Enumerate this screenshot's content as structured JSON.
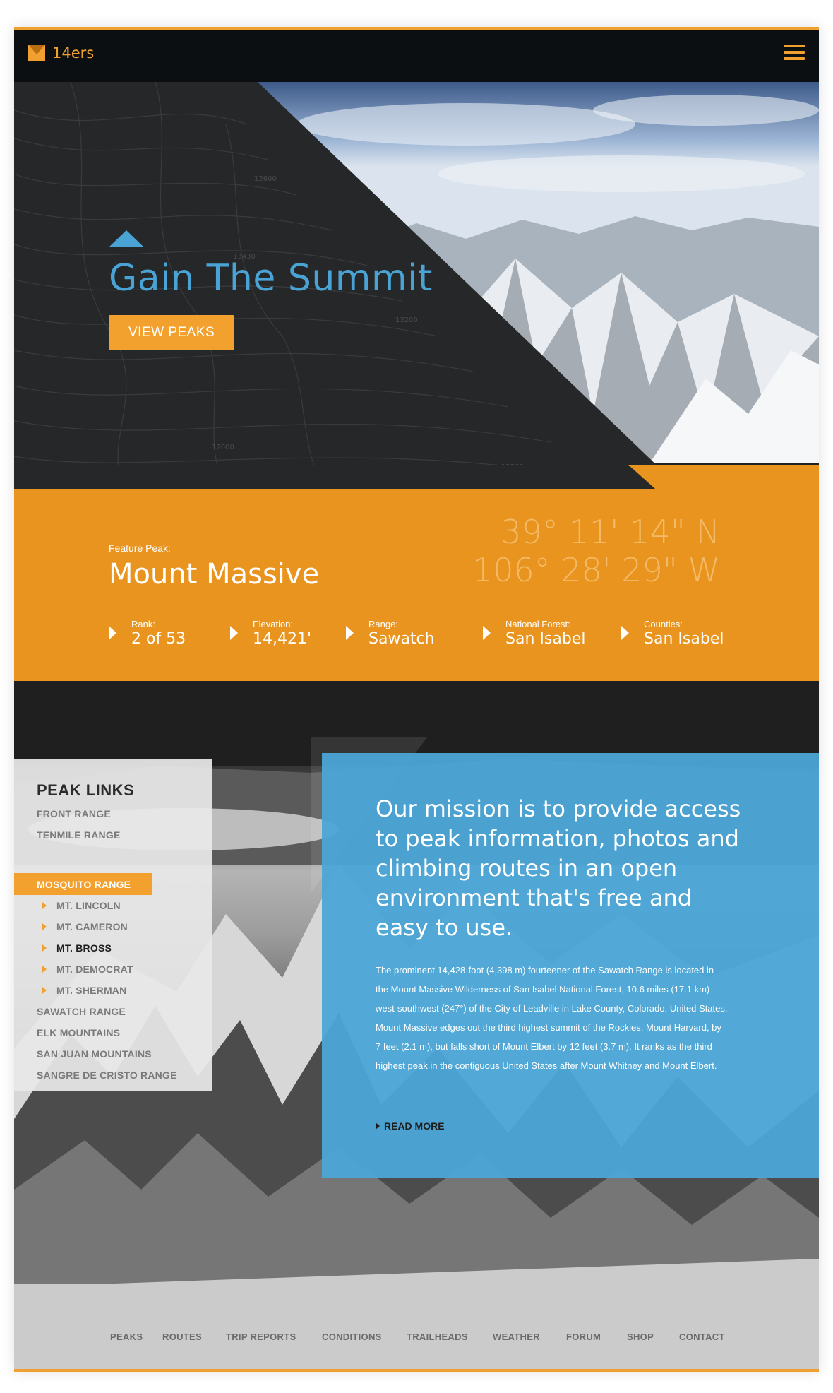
{
  "brand": {
    "name": "14ers",
    "accent": "#f1a02f",
    "blue": "#4aa3d5"
  },
  "header": {
    "menu_icon": "hamburger-icon"
  },
  "hero": {
    "title": "Gain The Summit",
    "button": "VIEW PEAKS"
  },
  "feature": {
    "label": "Feature Peak:",
    "name": "Mount Massive",
    "lat": "39° 11' 14\" N",
    "lon": "106° 28' 29\" W",
    "stats": [
      {
        "label": "Rank:",
        "value": "2 of 53"
      },
      {
        "label": "Elevation:",
        "value": "14,421'"
      },
      {
        "label": "Range:",
        "value": "Sawatch"
      },
      {
        "label": "National Forest:",
        "value": "San Isabel"
      },
      {
        "label": "Counties:",
        "value": "San Isabel"
      }
    ]
  },
  "peak_links": {
    "title": "PEAK LINKS",
    "items": [
      "FRONT RANGE",
      "TENMILE RANGE",
      "MOSQUITO RANGE",
      "MT. LINCOLN",
      "MT. CAMERON",
      "MT. BROSS",
      "MT. DEMOCRAT",
      "MT. SHERMAN",
      "SAWATCH RANGE",
      "ELK MOUNTAINS",
      "SAN JUAN MOUNTAINS",
      "SANGRE DE CRISTO RANGE"
    ]
  },
  "mission": {
    "heading": "Our mission is to provide access to peak information, photos and climbing routes in an open environment that's free and easy to use.",
    "body": "The prominent 14,428-foot (4,398 m) fourteener of the Sawatch Range is located in the Mount Massive Wilderness of San Isabel National Forest, 10.6 miles (17.1 km) west-southwest (247°) of the City of Leadville in Lake County, Colorado, United States. Mount Massive edges out the third highest summit of the Rockies, Mount Harvard, by 7 feet (2.1 m), but falls short of Mount Elbert by 12 feet (3.7 m). It ranks as the third highest peak in the contiguous United States after Mount Whitney and Mount Elbert.",
    "read_more": "READ MORE"
  },
  "footer": {
    "links": [
      "PEAKS",
      "ROUTES",
      "TRIP REPORTS",
      "CONDITIONS",
      "TRAILHEADS",
      "WEATHER",
      "FORUM",
      "SHOP",
      "CONTACT"
    ]
  }
}
